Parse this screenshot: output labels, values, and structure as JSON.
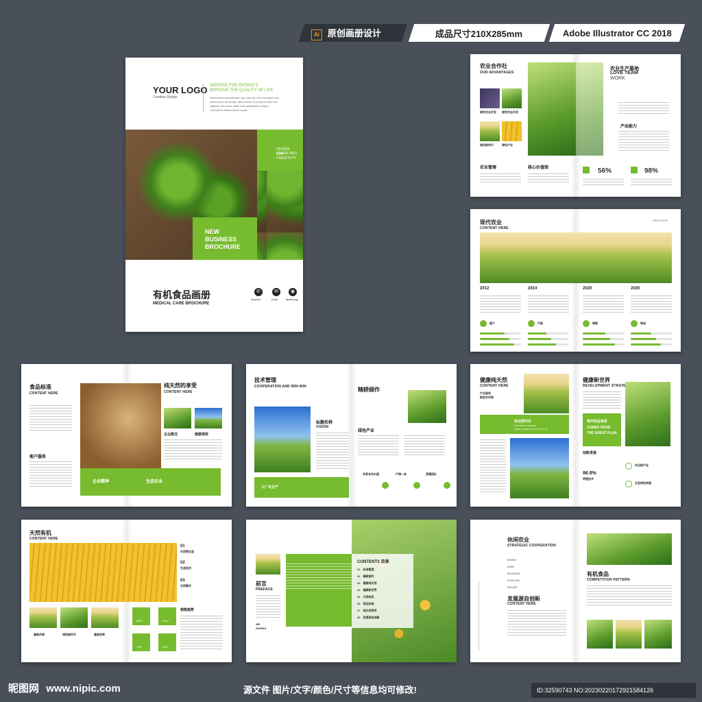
{
  "header": {
    "tag1": "原创画册设计",
    "tag1_badge": "Ai",
    "tag2": "成品尺寸210X285mm",
    "tag3": "Adobe Illustrator CC 2018"
  },
  "cover": {
    "logo": "YOUR LOGO",
    "logo_sub": "Creative Design",
    "service_line1": "SERVICE FOR PATIENTS",
    "service_line2": "IMPROVE THE QUALITY OF LIFE",
    "lorem": "Remmenem facciaborem aut eum lab orem hanupta volo dolum esec deraculas, alius dolum ut et ipsum facit eum fugitatur. Ed molor odion eum quidipidum solupa volorepeel andam ista is cupici.",
    "design_guidelines_1": "DESIGN GUIDELINES",
    "design_guidelines_2": "FOR CREATIVITY",
    "new": "NEW",
    "business": "BUSINESS",
    "brochure": "BROCHURE",
    "title_cn": "有机食品画册",
    "title_en": "MEDICAL CARE BROCHURE",
    "contacts": [
      {
        "label": "Telephone",
        "icon": "phone-icon",
        "glyph": "✆"
      },
      {
        "label": "E-mail",
        "icon": "mail-icon",
        "glyph": "✉"
      },
      {
        "label": "QQ Message",
        "icon": "chat-icon",
        "glyph": "◉"
      }
    ]
  },
  "spread1": {
    "title": "农业合作社",
    "our_adv": "OUR ADVANTAGES",
    "grid": [
      "绿色农业开发",
      "绿色农业开发",
      "绿色新时代",
      "绿色产业"
    ],
    "bottom_left": "农业管理",
    "bottom_right": "核心价值观",
    "right_title1": "农业生产基地",
    "right_title2": "LOVE TEAM",
    "right_title3": "WORK",
    "capacity": "产出能力",
    "stat1": "56%",
    "stat2": "98%"
  },
  "spread2": {
    "title": "现代农业",
    "sub": "CONTENT HERE",
    "page": "PAGE 01/02",
    "years": [
      "2012",
      "2014",
      "2020",
      "2030"
    ],
    "stats": [
      "客户",
      "产能",
      "销售",
      "物流"
    ],
    "bars": [
      0.6,
      0.45,
      0.55,
      0.5
    ]
  },
  "spread3": {
    "title": "食品标准",
    "sub": "CONTENT HERE",
    "right_title": "纯天然的享受",
    "right_sub": "CONTENT HERE",
    "label1": "企业概况",
    "label2": "健康源泉",
    "service": "客户服务",
    "green1": "企业精神",
    "green2": "生态农业"
  },
  "spread4": {
    "title": "技术管理",
    "sub": "COOPERATION AND WIN-WIN",
    "vision": "标题名称",
    "vision_en": "VISION",
    "right_title": "精耕细作",
    "green_industry": "绿色产业",
    "items": [
      "共享合作价值",
      "产销一体",
      "逻辑团队"
    ],
    "green_label": "工厂化生产"
  },
  "spread5": {
    "title": "健康纯天然",
    "sub": "CONTENT HERE",
    "item1": "产业服务",
    "item2": "新型农作物",
    "box_title": "农业现代化",
    "box_sub": "INNOVATION LEADING",
    "box_sub2": "MAKE CHANGE THE COUNT PLAN",
    "right_title": "健康新世界",
    "right_sub": "DEVELOPMENT STRATEGY",
    "green_box1": "现代农业体系",
    "green_box2": "COMES FROM",
    "green_box3": "THE GREAT PLAN",
    "innovation": "创新发展",
    "pct": "96.8%",
    "pct_label": "养殖技术",
    "r1": "农业新产品",
    "r2": "生态绿色种植"
  },
  "spread6": {
    "title": "天然有机",
    "sub": "CONTENT HERE",
    "nums": [
      "01",
      "02",
      "03"
    ],
    "num_labels": [
      "天然果生态",
      "生态经济",
      "天然精华"
    ],
    "captions": [
      "基础作物",
      "绿色新时代",
      "基础培育"
    ],
    "sales": "销售趋势",
    "tiles": [
      "850+",
      "1200+",
      "750+",
      "600+"
    ]
  },
  "spread7": {
    "preface": "前言",
    "preface_en": "PREFACE",
    "contents": "CONTENTS 目录",
    "toc": [
      {
        "n": "01",
        "t": "标准管理"
      },
      {
        "n": "02",
        "t": "精耕细作"
      },
      {
        "n": "03",
        "t": "健康纯天然"
      },
      {
        "n": "04",
        "t": "健康新世界"
      },
      {
        "n": "05",
        "t": "天然有机"
      },
      {
        "n": "06",
        "t": "食品标准"
      },
      {
        "n": "07",
        "t": "纯天然享受"
      },
      {
        "n": "08",
        "t": "发展源自创新"
      }
    ],
    "we": "WE",
    "works": "WORKS"
  },
  "spread8": {
    "title": "休闲农业",
    "sub": "STRATEGIC COOPERATION",
    "nums": [
      "800000",
      "8,800",
      "86,000000",
      "5,800,000",
      "500,000"
    ],
    "dev_title": "发展源自创新",
    "dev_sub": "CONTENT HERE",
    "right_title": "有机食品",
    "right_sub": "COMPETITION PATTERN"
  },
  "footer": {
    "site_cn": "昵图网",
    "site": "www.nipic.com",
    "notice": "源文件  图片/文字/颜色/尺寸等信息均可修改!",
    "id": "ID:32590743 NO:20230220172921584126"
  }
}
